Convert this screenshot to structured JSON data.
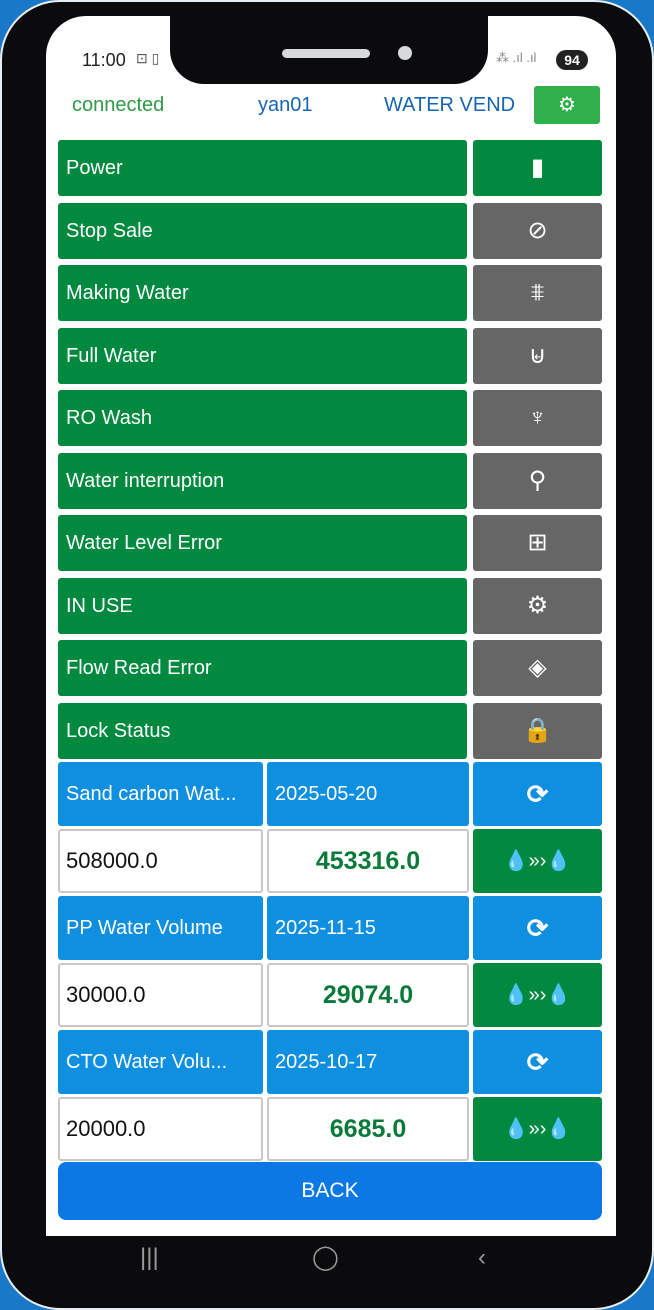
{
  "status_bar": {
    "time": "11:00",
    "left_icons": "⊡ ▯",
    "right_icons": "⁂ .ıl .ıl",
    "battery": "94"
  },
  "header": {
    "connection": "connected",
    "device": "yan01",
    "app_name": "WATER VEND",
    "settings_icon": "gears-icon"
  },
  "status_rows": [
    {
      "label": "Power",
      "icon": "▮",
      "icon_name": "power-indicator-icon",
      "active": true
    },
    {
      "label": "Stop Sale",
      "icon": "⊘",
      "icon_name": "stop-sale-icon",
      "active": false
    },
    {
      "label": "Making Water",
      "icon": "⩨",
      "icon_name": "making-water-icon",
      "active": false
    },
    {
      "label": "Full Water",
      "icon": "⊌",
      "icon_name": "full-tank-icon",
      "active": false
    },
    {
      "label": "RO Wash",
      "icon": "♆",
      "icon_name": "ro-wash-icon",
      "active": false
    },
    {
      "label": "Water interruption",
      "icon": "⚲",
      "icon_name": "faucet-icon",
      "active": false
    },
    {
      "label": "Water Level Error",
      "icon": "⊞",
      "icon_name": "water-level-error-icon",
      "active": false
    },
    {
      "label": "IN USE",
      "icon": "⚙",
      "icon_name": "in-use-gears-icon",
      "active": false
    },
    {
      "label": "Flow Read Error",
      "icon": "◈",
      "icon_name": "flow-error-icon",
      "active": false
    },
    {
      "label": "Lock Status",
      "icon": "🔒",
      "icon_name": "lock-icon",
      "active": false
    }
  ],
  "filters": [
    {
      "name": "Sand carbon Wat...",
      "date": "2025-05-20",
      "limit": "508000.0",
      "used": "453316.0"
    },
    {
      "name": "PP Water Volume",
      "date": "2025-11-15",
      "limit": "30000.0",
      "used": "29074.0"
    },
    {
      "name": "CTO Water Volu...",
      "date": "2025-10-17",
      "limit": "20000.0",
      "used": "6685.0"
    }
  ],
  "icons": {
    "reset": "⟳",
    "transfer": "💧»›💧"
  },
  "back_label": "BACK",
  "nav": {
    "recent": "|||",
    "home": "◯",
    "back": "‹"
  },
  "colors": {
    "active_green": "#00893f",
    "inactive_gray": "#666666",
    "filter_blue": "#0e8fe0",
    "back_blue": "#0c78e4",
    "value_green": "#0a7a3a"
  }
}
